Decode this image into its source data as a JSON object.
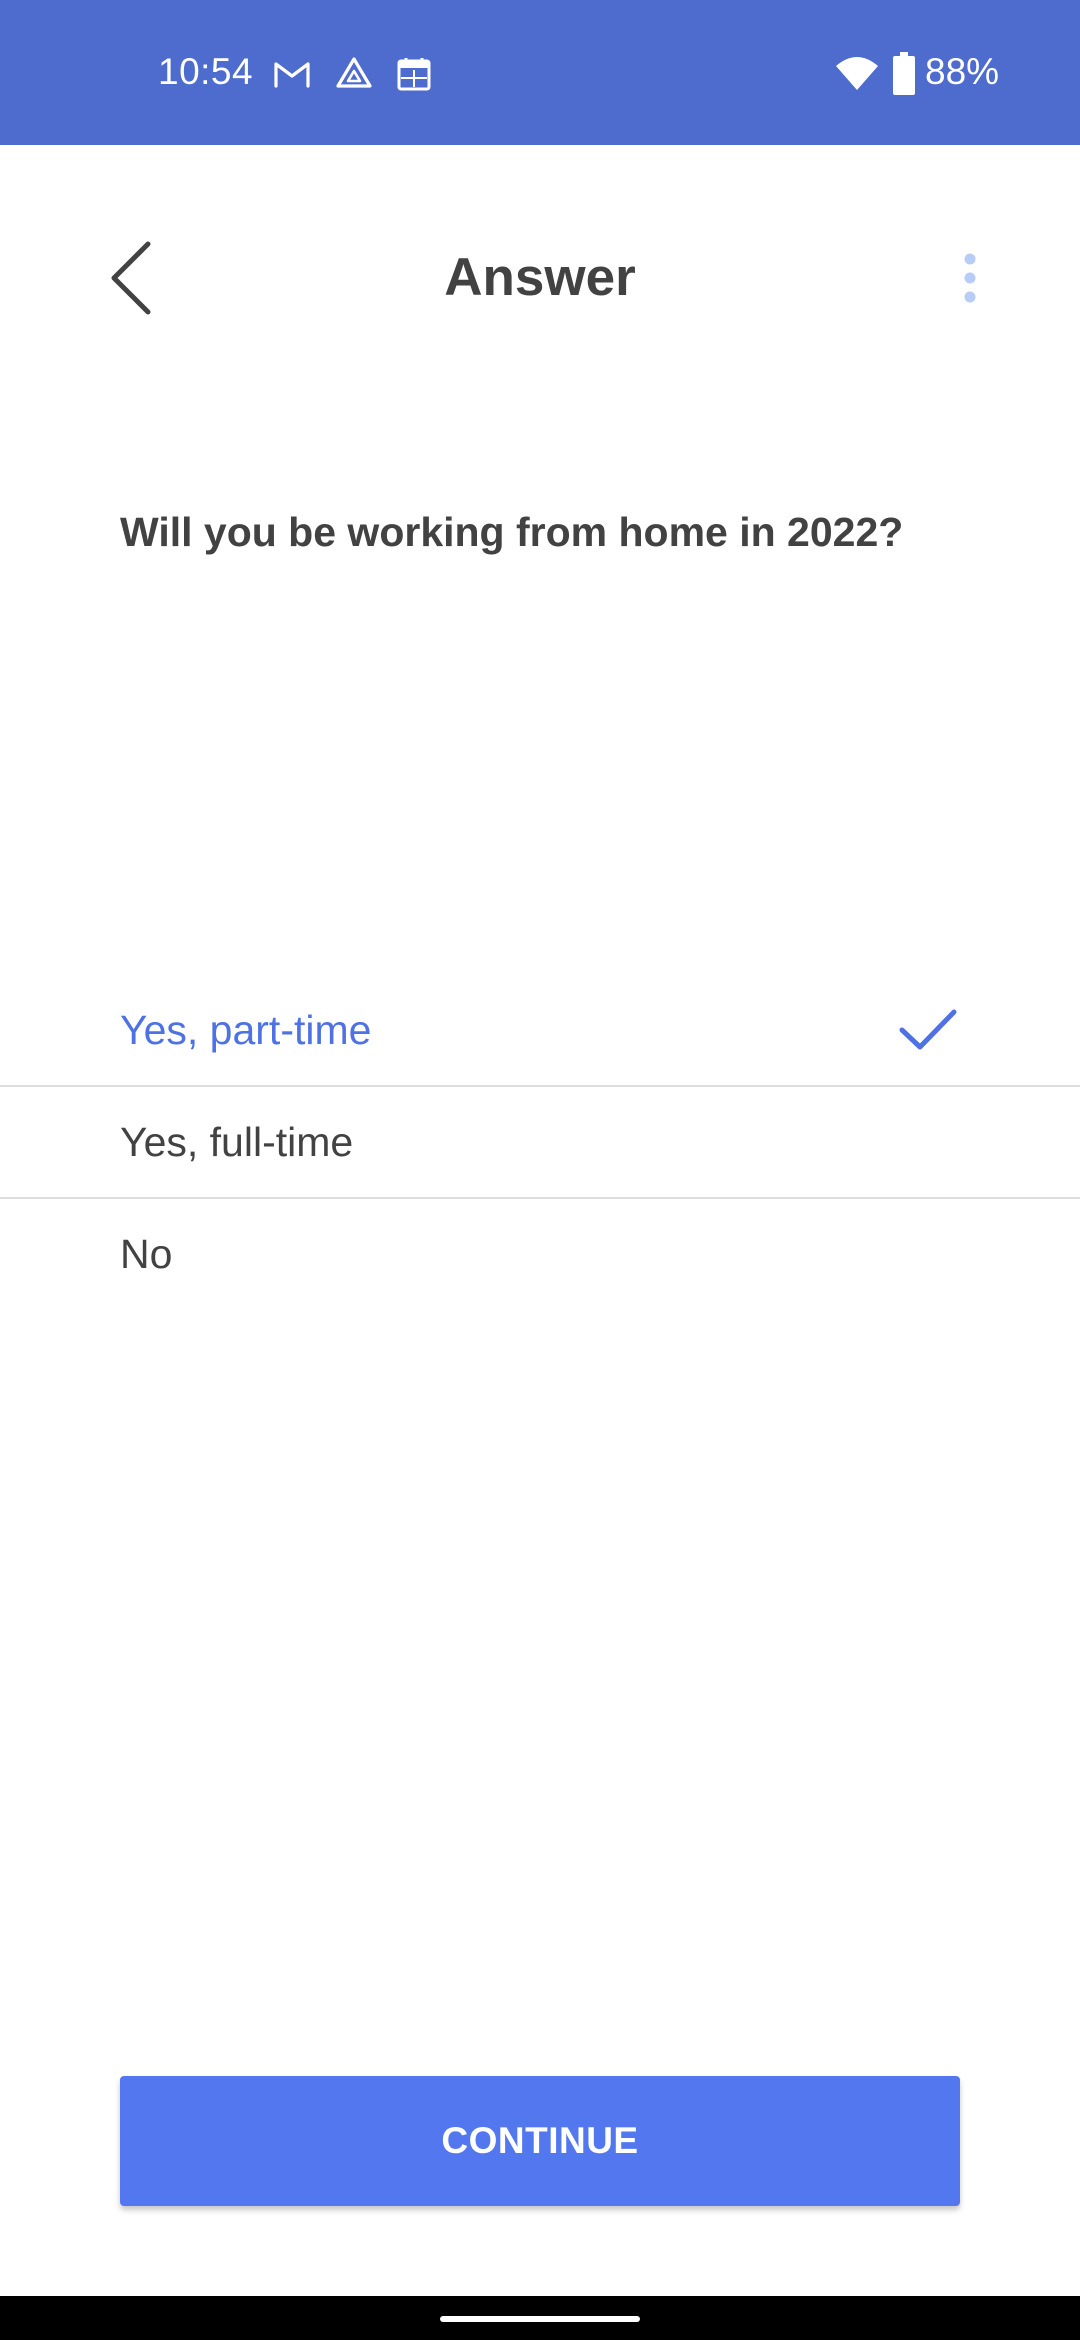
{
  "status_bar": {
    "time": "10:54",
    "battery_percent": "88%",
    "background_color": "#4e6bce",
    "icons": [
      "gmail-icon",
      "drive-icon",
      "calendar-icon",
      "wifi-icon",
      "battery-icon"
    ]
  },
  "header": {
    "title": "Answer",
    "back_icon": "chevron-left-icon",
    "menu_icon": "more-vertical-icon"
  },
  "question": {
    "text": "Will you be working from home in 2022?"
  },
  "options": [
    {
      "label": "Yes, part-time",
      "selected": true
    },
    {
      "label": "Yes, full-time",
      "selected": false
    },
    {
      "label": "No",
      "selected": false
    }
  ],
  "continue_button": {
    "label": "CONTINUE"
  },
  "colors": {
    "accent": "#5377ee",
    "selected_text": "#4e72e4",
    "text": "#424242",
    "divider": "#dddddd"
  }
}
